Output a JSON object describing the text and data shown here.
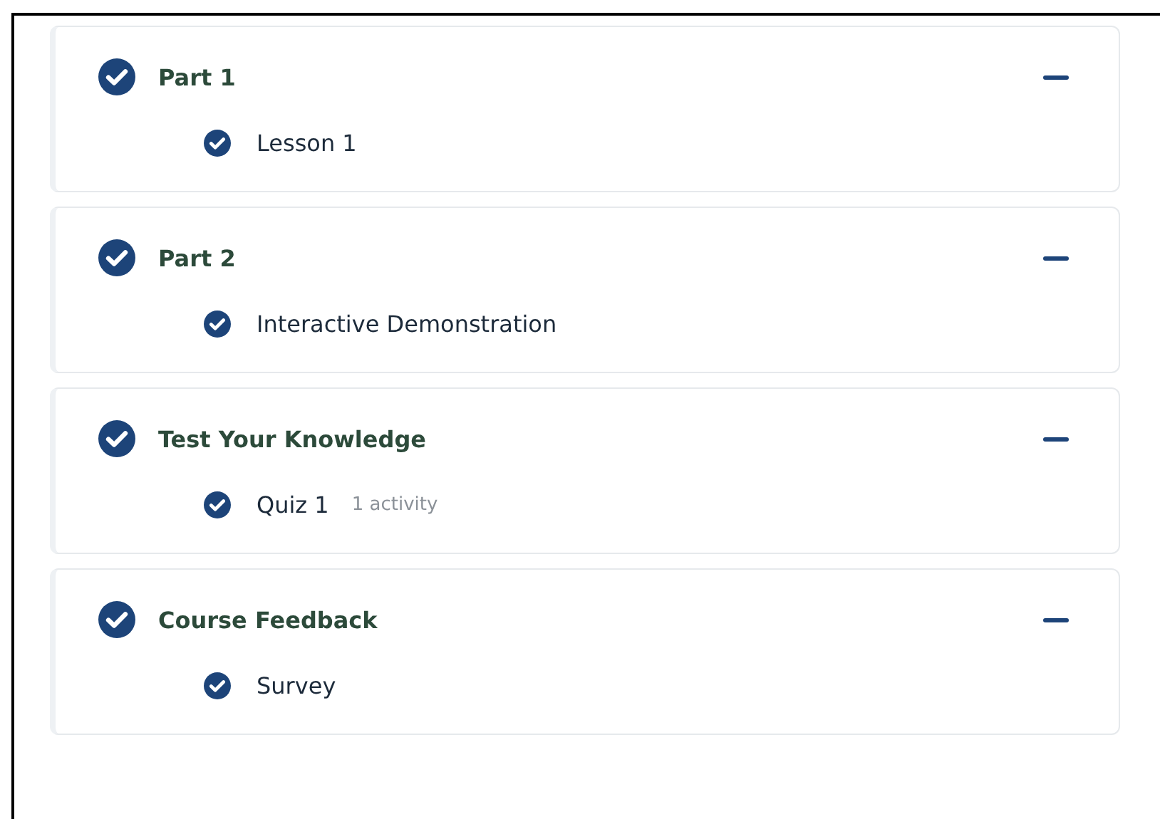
{
  "sections": [
    {
      "title": "Part 1",
      "completed": true,
      "expanded": true,
      "items": [
        {
          "label": "Lesson 1",
          "completed": true
        }
      ]
    },
    {
      "title": "Part 2",
      "completed": true,
      "expanded": true,
      "items": [
        {
          "label": "Interactive Demonstration",
          "completed": true
        }
      ]
    },
    {
      "title": "Test Your Knowledge",
      "completed": true,
      "expanded": true,
      "items": [
        {
          "label": "Quiz 1",
          "completed": true,
          "meta": "1 activity"
        }
      ]
    },
    {
      "title": "Course Feedback",
      "completed": true,
      "expanded": true,
      "items": [
        {
          "label": "Survey",
          "completed": true
        }
      ]
    }
  ]
}
